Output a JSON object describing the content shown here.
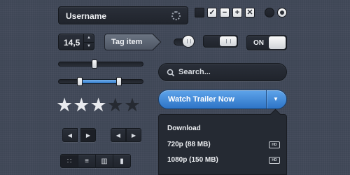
{
  "username_field": {
    "value": "Username"
  },
  "checkboxes": [
    "",
    "✓",
    "−",
    "+",
    "✕"
  ],
  "stepper": {
    "value": "14,5",
    "up_glyph": "▲",
    "down_glyph": "▼"
  },
  "tag": {
    "label": "Tag item"
  },
  "toggle": {
    "label": "ON"
  },
  "search": {
    "placeholder": "Search...",
    "icon": "search-icon"
  },
  "rating": {
    "stars_total": 5,
    "stars_filled": 3,
    "glyph": "★"
  },
  "watch_button": {
    "label": "Watch Trailer Now",
    "arrow": "▼"
  },
  "dropdown": {
    "title": "Download",
    "items": [
      {
        "label": "720p (88 MB)",
        "badge": "HD"
      },
      {
        "label": "1080p (150 MB)",
        "badge": "HD"
      }
    ]
  },
  "pager1": {
    "prev": "◀",
    "next": "▶"
  },
  "pager2": {
    "prev": "◀",
    "next": "▶"
  },
  "view_switch": {
    "grid": "∷",
    "list": "≡",
    "columns": "▥",
    "film": "▮"
  },
  "colors": {
    "background": "#3f4756",
    "accent_blue": "#3d87d8",
    "dark_control": "#22262e"
  }
}
